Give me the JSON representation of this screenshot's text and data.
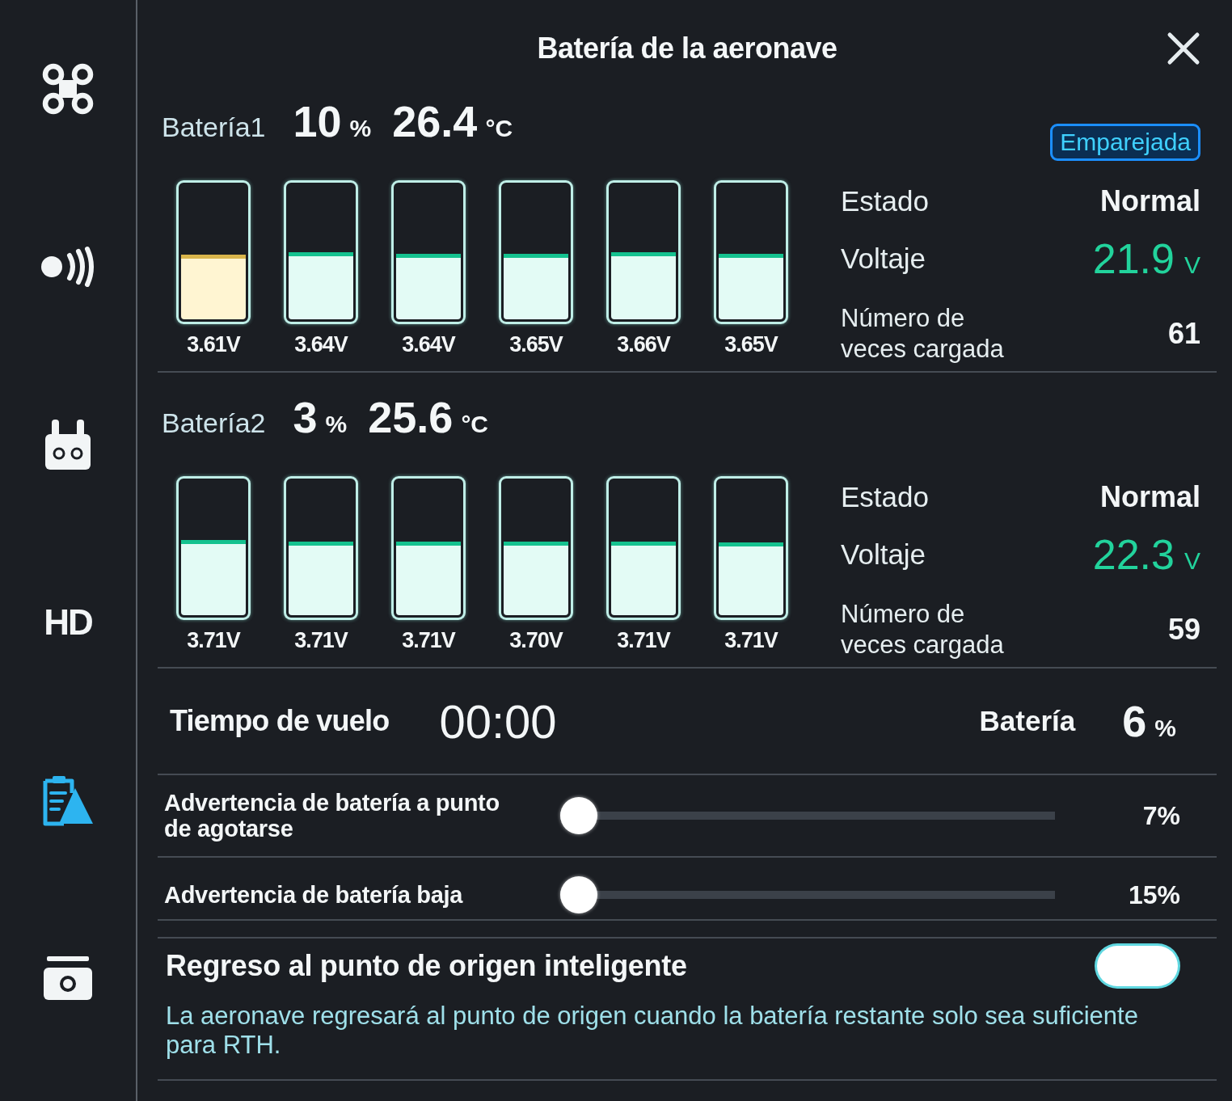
{
  "sidebar": {
    "items": [
      {
        "kind": "drone",
        "selected": false
      },
      {
        "kind": "signal",
        "selected": false
      },
      {
        "kind": "controller",
        "selected": false
      },
      {
        "kind": "text",
        "label": "HD",
        "selected": false
      },
      {
        "kind": "battery",
        "selected": true
      },
      {
        "kind": "camera",
        "selected": false
      }
    ]
  },
  "title": "Batería de la aeronave",
  "batteries": [
    {
      "name": "Batería1",
      "charge": "10",
      "charge_unit": "%",
      "temperature": "26.4",
      "temperature_unit": "°C",
      "badge": "Emparejada",
      "cells": [
        {
          "voltage": "3.61V",
          "level": 0.48,
          "low": true
        },
        {
          "voltage": "3.64V",
          "level": 0.5,
          "low": false
        },
        {
          "voltage": "3.64V",
          "level": 0.49,
          "low": false
        },
        {
          "voltage": "3.65V",
          "level": 0.49,
          "low": false
        },
        {
          "voltage": "3.66V",
          "level": 0.5,
          "low": false
        },
        {
          "voltage": "3.65V",
          "level": 0.49,
          "low": false
        }
      ],
      "status": {
        "label": "Estado",
        "value": "Normal"
      },
      "voltage": {
        "label": "Voltaje",
        "value": "21.9",
        "unit": "V"
      },
      "charge_count": {
        "label": "Número de veces cargada",
        "value": "61"
      }
    },
    {
      "name": "Batería2",
      "charge": "3",
      "charge_unit": "%",
      "temperature": "25.6",
      "temperature_unit": "°C",
      "cells": [
        {
          "voltage": "3.71V",
          "level": 0.56,
          "low": false
        },
        {
          "voltage": "3.71V",
          "level": 0.55,
          "low": false
        },
        {
          "voltage": "3.71V",
          "level": 0.55,
          "low": false
        },
        {
          "voltage": "3.70V",
          "level": 0.55,
          "low": false
        },
        {
          "voltage": "3.71V",
          "level": 0.55,
          "low": false
        },
        {
          "voltage": "3.71V",
          "level": 0.54,
          "low": false
        }
      ],
      "status": {
        "label": "Estado",
        "value": "Normal"
      },
      "voltage": {
        "label": "Voltaje",
        "value": "22.3",
        "unit": "V"
      },
      "charge_count": {
        "label": "Número de veces cargada",
        "value": "59"
      }
    }
  ],
  "flight": {
    "time_label": "Tiempo de vuelo",
    "time": "00:00",
    "battery_label": "Batería",
    "battery": "6",
    "battery_unit": "%"
  },
  "warnings": [
    {
      "label": "Advertencia de batería a punto de agotarse",
      "level": 0,
      "reading": "7%"
    },
    {
      "label": "Advertencia de batería baja",
      "level": 0,
      "reading": "15%"
    }
  ],
  "smart_return": {
    "title": "Regreso al punto de origen inteligente",
    "on": true,
    "description": "La aeronave regresará al punto de origen cuando la batería restante solo sea suficiente para RTH."
  }
}
